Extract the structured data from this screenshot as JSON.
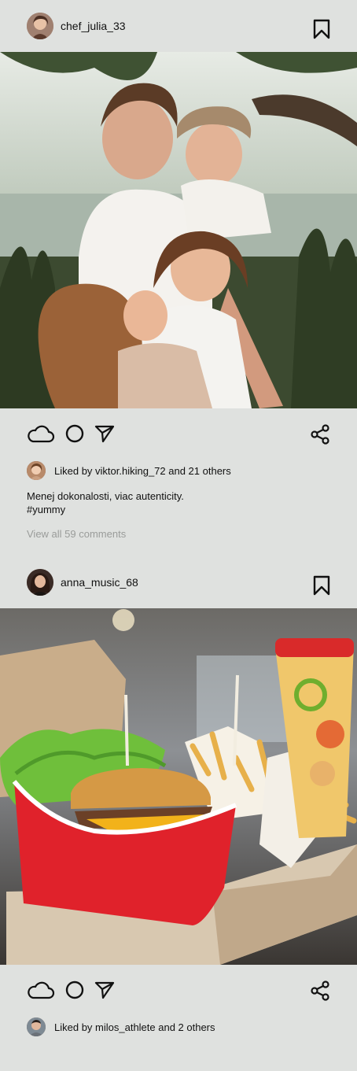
{
  "posts": [
    {
      "username": "chef_julia_33",
      "avatar_icon": "user-avatar",
      "bookmark_icon": "bookmark-icon",
      "photo_alt": "family-photo",
      "actions": [
        "like-cloud-icon",
        "comment-circle-icon",
        "send-triangle-icon",
        "share-icon"
      ],
      "liked_by": "Liked by viktor.hiking_72 and 21 others",
      "caption_line1": "Menej dokonalosti, viac autenticity.",
      "caption_line2": "#yummy",
      "view_comments": "View all 59 comments"
    },
    {
      "username": "anna_music_68",
      "avatar_icon": "user-avatar",
      "bookmark_icon": "bookmark-icon",
      "photo_alt": "burger-fries-photo",
      "actions": [
        "like-cloud-icon",
        "comment-circle-icon",
        "send-triangle-icon",
        "share-icon"
      ],
      "liked_by": "Liked by milos_athlete and 2 others"
    }
  ],
  "colors": {
    "background": "#dfe1df",
    "text": "#111111",
    "muted": "#9a9c9a",
    "burger_box_red": "#e0222b"
  }
}
